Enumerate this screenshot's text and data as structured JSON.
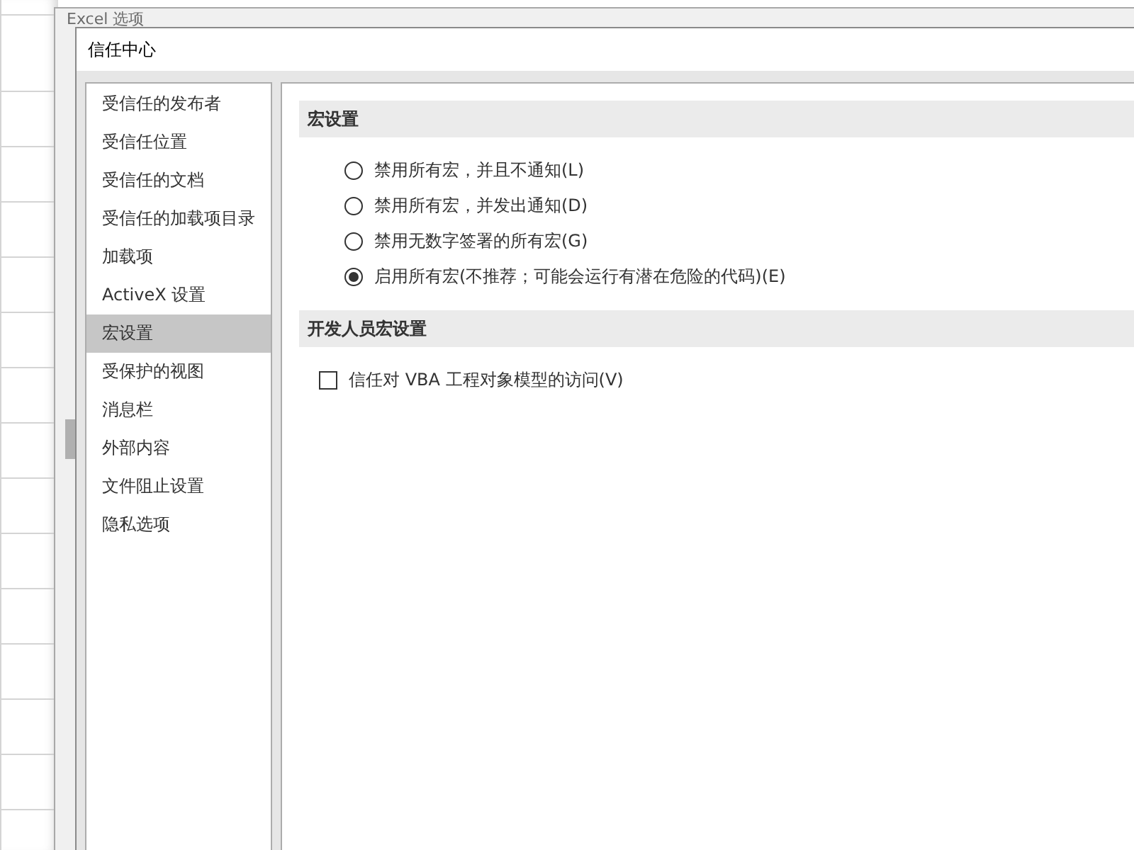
{
  "back_window": {
    "title": "Excel 选项"
  },
  "dialog": {
    "title": "信任中心"
  },
  "sidebar": {
    "items": [
      {
        "label": "受信任的发布者",
        "selected": false
      },
      {
        "label": "受信任位置",
        "selected": false
      },
      {
        "label": "受信任的文档",
        "selected": false
      },
      {
        "label": "受信任的加载项目录",
        "selected": false
      },
      {
        "label": "加载项",
        "selected": false
      },
      {
        "label": "ActiveX 设置",
        "selected": false
      },
      {
        "label": "宏设置",
        "selected": true
      },
      {
        "label": "受保护的视图",
        "selected": false
      },
      {
        "label": "消息栏",
        "selected": false
      },
      {
        "label": "外部内容",
        "selected": false
      },
      {
        "label": "文件阻止设置",
        "selected": false
      },
      {
        "label": "隐私选项",
        "selected": false
      }
    ]
  },
  "sections": [
    {
      "title": "宏设置",
      "options": [
        {
          "kind": "radio",
          "label": "禁用所有宏，并且不通知(L)",
          "selected": false
        },
        {
          "kind": "radio",
          "label": "禁用所有宏，并发出通知(D)",
          "selected": false
        },
        {
          "kind": "radio",
          "label": "禁用无数字签署的所有宏(G)",
          "selected": false
        },
        {
          "kind": "radio",
          "label": "启用所有宏(不推荐；可能会运行有潜在危险的代码)(E)",
          "selected": true
        }
      ]
    },
    {
      "title": "开发人员宏设置",
      "options": [
        {
          "kind": "checkbox",
          "label": "信任对 VBA 工程对象模型的访问(V)",
          "checked": false
        }
      ]
    }
  ]
}
